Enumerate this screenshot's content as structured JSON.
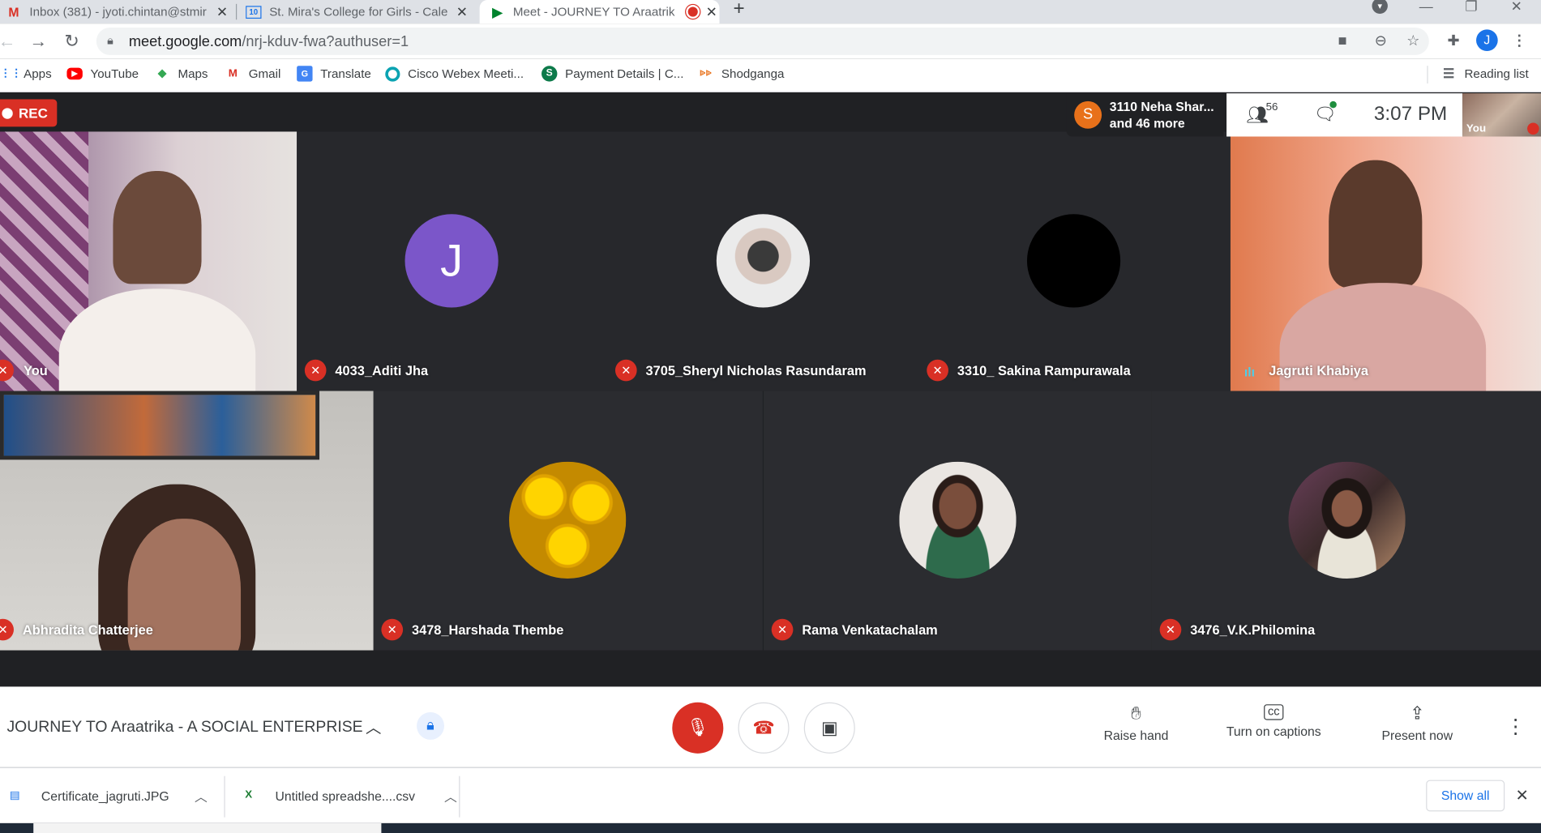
{
  "browser": {
    "tabs": [
      {
        "title": "Inbox (381) - jyoti.chintan@stmir",
        "icon": "gmail-icon"
      },
      {
        "title": "St. Mira's College for Girls - Caler",
        "icon": "calendar-icon"
      },
      {
        "title": "Meet - JOURNEY TO Araatrik",
        "icon": "meet-icon",
        "active": true
      }
    ],
    "url_main": "meet.google.com",
    "url_rest": "/nrj-kduv-fwa?authuser=1",
    "profile_initial": "J",
    "bookmarks": [
      "Apps",
      "YouTube",
      "Maps",
      "Gmail",
      "Translate",
      "Cisco Webex Meeti...",
      "Payment Details | C...",
      "Shodganga"
    ],
    "reading_list": "Reading list"
  },
  "meet": {
    "rec_label": "REC",
    "speaking": {
      "initial": "S",
      "line1": "3110 Neha Shar...",
      "line2": "and 46 more"
    },
    "participant_count": "56",
    "clock": "3:07 PM",
    "self_label": "You",
    "tiles": [
      {
        "name": "You",
        "muted": true
      },
      {
        "name": "4033_Aditi Jha",
        "muted": true,
        "initial": "J"
      },
      {
        "name": "3705_Sheryl Nicholas Rasundaram",
        "muted": true
      },
      {
        "name": "3310_ Sakina Rampurawala",
        "muted": true
      },
      {
        "name": "Jagruti Khabiya",
        "muted": false
      },
      {
        "name": "Abhradita Chatterjee",
        "muted": true
      },
      {
        "name": "3478_Harshada Thembe",
        "muted": true
      },
      {
        "name": "Rama Venkatachalam",
        "muted": true
      },
      {
        "name": "3476_V.K.Philomina",
        "muted": true
      }
    ],
    "meeting_name": "JOURNEY TO Araatrika - A SOCIAL ENTERPRISE",
    "actions": {
      "raise_hand": "Raise hand",
      "captions": "Turn on captions",
      "present": "Present now"
    }
  },
  "downloads": {
    "items": [
      "Certificate_jagruti.JPG",
      "Untitled spreadshe....csv"
    ],
    "show_all": "Show all"
  },
  "colors": {
    "accent": "#1a73e8",
    "danger": "#d93025",
    "meet_bg": "#202124"
  }
}
